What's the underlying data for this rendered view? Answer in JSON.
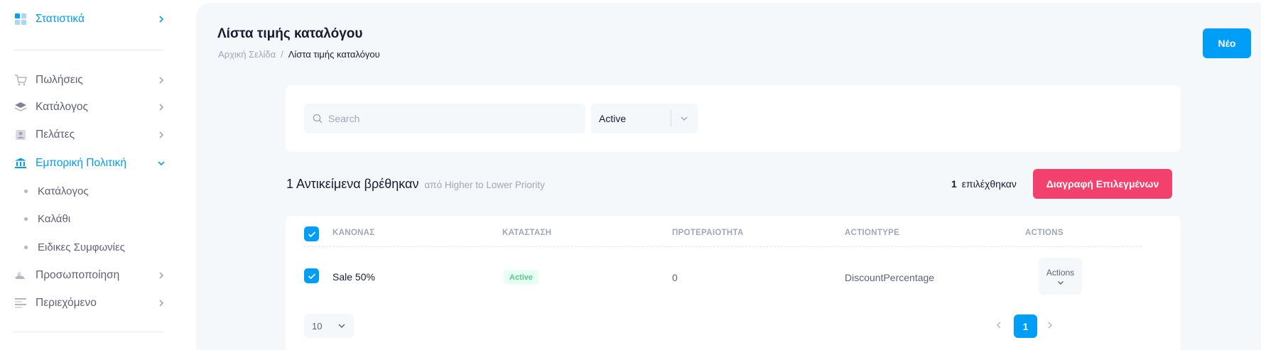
{
  "sidebar": {
    "items": [
      {
        "label": "Στατιστικά",
        "icon": "dashboard-icon"
      },
      {
        "label": "Πωλήσεις",
        "icon": "cart-icon"
      },
      {
        "label": "Κατάλογος",
        "icon": "layers-icon"
      },
      {
        "label": "Πελάτες",
        "icon": "contacts-icon"
      },
      {
        "label": "Εμπορική Πολιτική",
        "icon": "bank-icon"
      },
      {
        "label": "Προσωποποίηση",
        "icon": "weather-icon"
      },
      {
        "label": "Περιεχόμενο",
        "icon": "text-align-icon"
      }
    ],
    "sub_items": [
      {
        "label": "Κατάλογος"
      },
      {
        "label": "Καλάθι"
      },
      {
        "label": "Ειδικες Συμφωνίες"
      }
    ]
  },
  "header": {
    "title": "Λίστα τιμής καταλόγου",
    "breadcrumb_home": "Αρχική Σελίδα",
    "breadcrumb_sep": "/",
    "breadcrumb_current": "Λίστα τιμής καταλόγου",
    "new_label": "Νέο"
  },
  "filters": {
    "search_placeholder": "Search",
    "status_value": "Active"
  },
  "results": {
    "count_text": "1 Αντικείμενα βρέθηκαν",
    "sort_text": "από Higher to Lower Priority",
    "selected_count": "1",
    "selected_label": "επιλέχθηκαν",
    "delete_label": "Διαγραφή Επιλεγμένων"
  },
  "table": {
    "columns": [
      "ΚΑΝΟΝΑΣ",
      "ΚΑΤΑΣΤΑΣΗ",
      "ΠΡΟΤΕΡΑΙΟΤΗΤΑ",
      "ACTIONTYPE",
      "ACTIONS"
    ],
    "rows": [
      {
        "rule": "Sale 50%",
        "status": "Active",
        "priority": "0",
        "action_type": "DiscountPercentage",
        "actions_label": "Actions"
      }
    ]
  },
  "pagination": {
    "page_size": "10",
    "current_page": "1"
  },
  "colors": {
    "primary": "#009ef7",
    "danger": "#f1416c",
    "success": "#50cd89",
    "background": "#f5f8fa"
  }
}
